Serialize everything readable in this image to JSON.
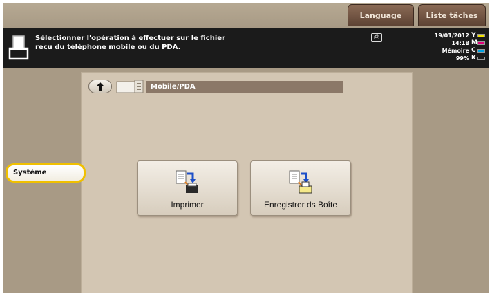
{
  "top_tabs": {
    "language": "Language",
    "job_list": "Liste tâches"
  },
  "message": {
    "line1": "Sélectionner l'opération à effectuer sur le fichier",
    "line2": "reçu du téléphone mobile ou du PDA."
  },
  "status": {
    "date": "19/01/2012",
    "time": "14:18",
    "memory_label": "Mémoire",
    "memory_value": "99%"
  },
  "toner": [
    {
      "letter": "Y",
      "color": "#f2e200"
    },
    {
      "letter": "M",
      "color": "#e0007a"
    },
    {
      "letter": "C",
      "color": "#00a0e0"
    },
    {
      "letter": "K",
      "color": "#1b1b1b"
    }
  ],
  "breadcrumb": {
    "path": "Mobile/PDA"
  },
  "actions": {
    "print_label": "Imprimer",
    "save_box_label": "Enregistrer ds Boîte"
  },
  "sidebar": {
    "system_label": "Système"
  },
  "colors": {
    "panel_bg": "#d3c6b3",
    "frame_bg": "#a89a85",
    "message_bar": "#1b1b1b",
    "tab_brown": "#5e4334",
    "system_highlight": "#f0c000"
  }
}
